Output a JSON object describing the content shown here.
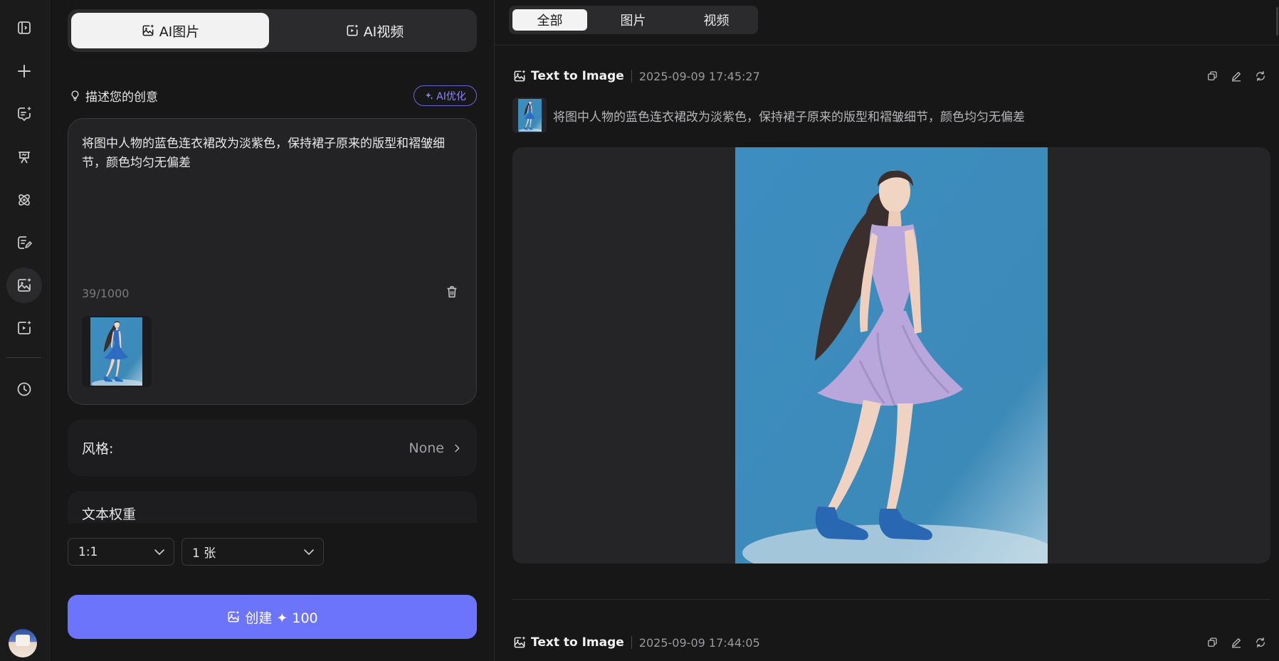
{
  "sidebar": {
    "icons": [
      "sidebar-toggle-icon",
      "plus-icon",
      "chat-sparkle-icon",
      "canvas-icon",
      "atom-icon",
      "edit-doc-icon",
      "image-sparkle-icon",
      "video-sparkle-icon",
      "clock-icon"
    ],
    "active": "image-sparkle-icon"
  },
  "mode_tabs": {
    "image": "AI图片",
    "video": "AI视频",
    "active": "image"
  },
  "prompt": {
    "label": "描述您的创意",
    "ai_optimize": "AI优化",
    "text": "将图中人物的蓝色连衣裙改为淡紫色，保持裙子原来的版型和褶皱细节，颜色均匀无偏差",
    "char_count": "39/1000"
  },
  "style": {
    "label": "风格:",
    "value": "None"
  },
  "text_weight": {
    "label": "文本权重"
  },
  "selects": {
    "ratio": "1:1",
    "count": "1 张"
  },
  "create_button": {
    "label": "创建 ✦ 100"
  },
  "filters": {
    "all": "全部",
    "image": "图片",
    "video": "视频",
    "active": "all"
  },
  "records": [
    {
      "type": "Text to Image",
      "time": "2025-09-09 17:45:27",
      "prompt": "将图中人物的蓝色连衣裙改为淡紫色，保持裙子原来的版型和褶皱细节，颜色均匀无偏差"
    },
    {
      "type": "Text to Image",
      "time": "2025-09-09 17:44:05"
    }
  ],
  "colors": {
    "accent": "#6c74fb",
    "ai_badge": "#8d89f0",
    "dress_original": "#2e6cc4",
    "dress_result": "#b9a7dc"
  }
}
